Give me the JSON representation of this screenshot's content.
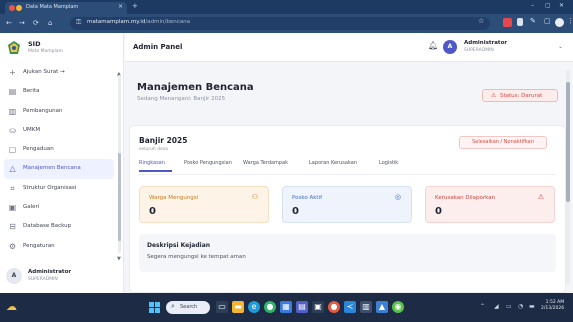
{
  "browser": {
    "tab_title": "Data Mata Mamplam",
    "tab_close": "×",
    "new_tab": "+",
    "url_host": "matamamplam.my.id",
    "url_path": "/admin/bencana",
    "nav_back": "←",
    "nav_forward": "→",
    "nav_reload": "⟳",
    "nav_home": "⌂"
  },
  "sidebar": {
    "brand_name": "SID",
    "brand_sub": "Mata Mamplam",
    "items": [
      {
        "label": "Ajukan Surat →",
        "icon": "plus-icon",
        "glyph": "+"
      },
      {
        "label": "Berita",
        "icon": "newspaper-icon",
        "glyph": "▤"
      },
      {
        "label": "Pembangunan",
        "icon": "building-icon",
        "glyph": "▥"
      },
      {
        "label": "UMKM",
        "icon": "shopping-bag-icon",
        "glyph": "⛀"
      },
      {
        "label": "Pengaduan",
        "icon": "chat-icon",
        "glyph": "▢"
      },
      {
        "label": "Manajemen Bencana",
        "icon": "warning-icon",
        "glyph": "△"
      },
      {
        "label": "Struktur Organisasi",
        "icon": "sitemap-icon",
        "glyph": "⌗"
      },
      {
        "label": "Galeri",
        "icon": "image-icon",
        "glyph": "▣"
      },
      {
        "label": "Database Backup",
        "icon": "database-icon",
        "glyph": "⊟"
      },
      {
        "label": "Pengaturan",
        "icon": "gear-icon",
        "glyph": "⚙"
      }
    ],
    "active_index": 5,
    "user_initial": "A",
    "user_name": "Administrator",
    "user_role": "SUPERADMIN"
  },
  "topbar": {
    "title": "Admin Panel",
    "user_initial": "A",
    "user_name": "Administrator",
    "user_role": "SUPERADMIN"
  },
  "page": {
    "title": "Manajemen Bencana",
    "subtitle": "Sedang Menangani: Banjir 2025",
    "status_label": "Status: Darurat"
  },
  "card": {
    "title": "Banjir 2025",
    "subtitle": "seluruh desa",
    "finish_button": "Selesaikan / Nonaktifkan",
    "tabs": [
      "Ringkasan",
      "Posko Pengungsian",
      "Warga Terdampak",
      "Laporan Kerusakan",
      "Logistik"
    ],
    "active_tab": 0,
    "stats": [
      {
        "label": "Warga Mengungsi",
        "value": "0",
        "icon": "users-icon",
        "glyph": "⚇"
      },
      {
        "label": "Posko Aktif",
        "value": "0",
        "icon": "location-pin-icon",
        "glyph": "◎"
      },
      {
        "label": "Kerusakan Dilaporkan",
        "value": "0",
        "icon": "alert-triangle-icon",
        "glyph": "⚠"
      }
    ],
    "description_title": "Deskripsi Kejadian",
    "description_text": "Segera mengungsi ke tempat aman"
  },
  "taskbar": {
    "search_label": "Search",
    "time": "1:52 AM",
    "date": "2/13/2026"
  },
  "colors": {
    "accent": "#4f58c9",
    "danger": "#d8473f",
    "warning": "#c97a1e",
    "info": "#3f6fc7"
  }
}
